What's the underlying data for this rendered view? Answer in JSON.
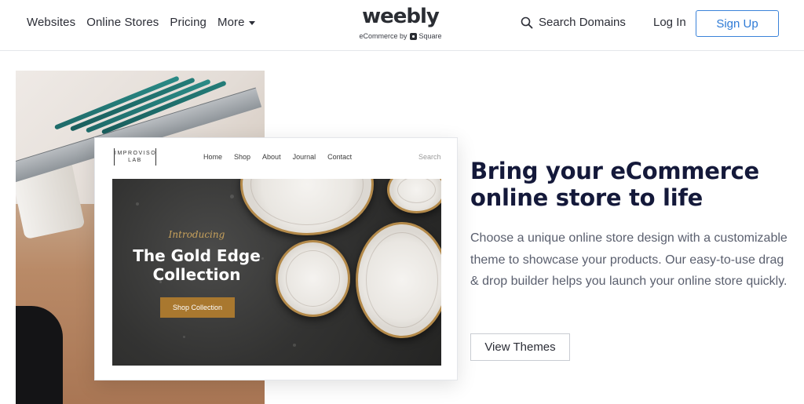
{
  "header": {
    "nav": [
      {
        "label": "Websites"
      },
      {
        "label": "Online Stores"
      },
      {
        "label": "Pricing"
      },
      {
        "label": "More"
      }
    ],
    "logo": {
      "wordmark": "weebly",
      "tagline": "eCommerce by",
      "partner": "Square"
    },
    "search_domains_label": "Search Domains",
    "login_label": "Log In",
    "signup_label": "Sign Up"
  },
  "mockup": {
    "logo_lines": [
      "IMPROVISO",
      "LAB"
    ],
    "nav": [
      {
        "label": "Home"
      },
      {
        "label": "Shop"
      },
      {
        "label": "About"
      },
      {
        "label": "Journal"
      },
      {
        "label": "Contact"
      }
    ],
    "search_label": "Search",
    "hero": {
      "intro": "Introducing",
      "title_line1": "The Gold Edge",
      "title_line2": "Collection",
      "button_label": "Shop Collection"
    }
  },
  "main": {
    "headline_line1": "Bring your eCommerce",
    "headline_line2": "online store to life",
    "body": "Choose a unique online store design with a customizable theme to showcase your products. Our easy-to-use drag & drop builder helps you launch your online store quickly.",
    "cta_label": "View Themes"
  },
  "colors": {
    "accent_blue": "#3b83d9",
    "headline_navy": "#14193a",
    "gold": "#a9782f"
  }
}
